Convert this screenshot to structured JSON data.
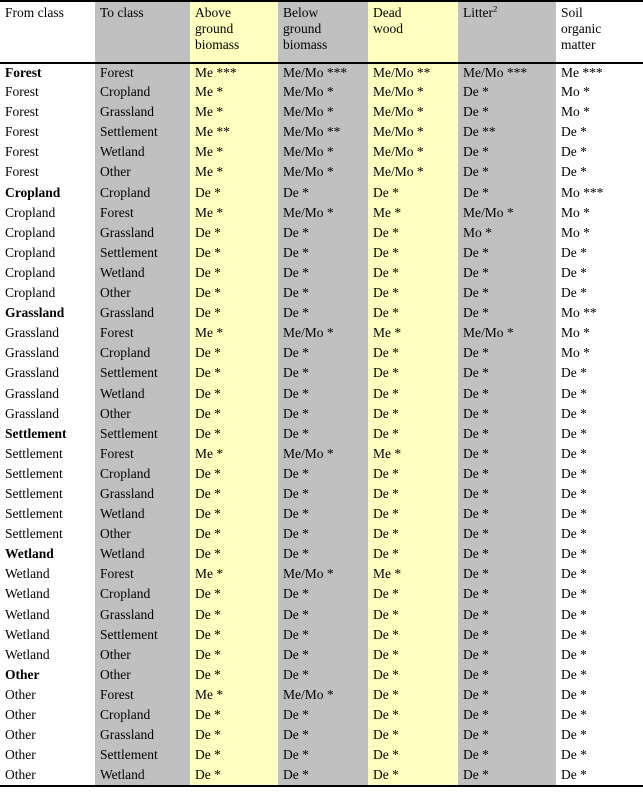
{
  "table": {
    "headers": [
      {
        "id": "from-class",
        "label": "From class",
        "lines": [
          "From class"
        ],
        "tint": "white",
        "superscript": ""
      },
      {
        "id": "to-class",
        "label": "To class",
        "lines": [
          "To class"
        ],
        "tint": "gray",
        "superscript": ""
      },
      {
        "id": "above-ground-biomass",
        "label": "Above ground biomass",
        "lines": [
          "Above",
          "ground",
          "biomass"
        ],
        "tint": "yellow",
        "superscript": ""
      },
      {
        "id": "below-ground-biomass",
        "label": "Below ground biomass",
        "lines": [
          "Below",
          "ground",
          "biomass"
        ],
        "tint": "gray",
        "superscript": ""
      },
      {
        "id": "dead-wood",
        "label": "Dead wood",
        "lines": [
          "Dead",
          "wood"
        ],
        "tint": "yellow",
        "superscript": ""
      },
      {
        "id": "litter",
        "label": "Litter",
        "lines": [
          "Litter"
        ],
        "tint": "gray",
        "superscript": "2"
      },
      {
        "id": "soil-organic-matter",
        "label": "Soil organic matter",
        "lines": [
          "Soil",
          "organic",
          "matter"
        ],
        "tint": "white",
        "superscript": ""
      }
    ],
    "column_tints": [
      "white",
      "gray",
      "yellow",
      "gray",
      "yellow",
      "gray",
      "white"
    ],
    "colors": {
      "yellow_tint": "#ffffc0",
      "gray_tint": "#c0c0c0",
      "white_tint": "#ffffff",
      "border": "#000000",
      "text": "#000000"
    },
    "rows": [
      {
        "from": "Forest",
        "from_bold": true,
        "to": "Forest",
        "values": [
          "Me ***",
          "Me/Mo ***",
          "Me/Mo **",
          "Me/Mo ***",
          "Me ***"
        ]
      },
      {
        "from": "Forest",
        "from_bold": false,
        "to": "Cropland",
        "values": [
          "Me *",
          "Me/Mo *",
          "Me/Mo *",
          "De *",
          "Mo *"
        ]
      },
      {
        "from": "Forest",
        "from_bold": false,
        "to": "Grassland",
        "values": [
          "Me *",
          "Me/Mo *",
          "Me/Mo *",
          "De *",
          "Mo *"
        ]
      },
      {
        "from": "Forest",
        "from_bold": false,
        "to": "Settlement",
        "values": [
          "Me **",
          "Me/Mo **",
          "Me/Mo *",
          "De **",
          "De *"
        ]
      },
      {
        "from": "Forest",
        "from_bold": false,
        "to": "Wetland",
        "values": [
          "Me *",
          "Me/Mo *",
          "Me/Mo *",
          "De *",
          "De *"
        ]
      },
      {
        "from": "Forest",
        "from_bold": false,
        "to": "Other",
        "values": [
          "Me *",
          "Me/Mo *",
          "Me/Mo *",
          "De *",
          "De *"
        ]
      },
      {
        "from": "Cropland",
        "from_bold": true,
        "to": "Cropland",
        "values": [
          "De *",
          "De *",
          "De *",
          "De *",
          "Mo ***"
        ]
      },
      {
        "from": "Cropland",
        "from_bold": false,
        "to": "Forest",
        "values": [
          "Me *",
          "Me/Mo *",
          "Me *",
          "Me/Mo *",
          "Mo *"
        ]
      },
      {
        "from": "Cropland",
        "from_bold": false,
        "to": "Grassland",
        "values": [
          "De *",
          "De *",
          "De *",
          "Mo *",
          "Mo *"
        ]
      },
      {
        "from": "Cropland",
        "from_bold": false,
        "to": "Settlement",
        "values": [
          "De *",
          "De *",
          "De *",
          "De *",
          "De *"
        ]
      },
      {
        "from": "Cropland",
        "from_bold": false,
        "to": "Wetland",
        "values": [
          "De *",
          "De *",
          "De *",
          "De *",
          "De *"
        ]
      },
      {
        "from": "Cropland",
        "from_bold": false,
        "to": "Other",
        "values": [
          "De *",
          "De *",
          "De *",
          "De *",
          "De *"
        ]
      },
      {
        "from": "Grassland",
        "from_bold": true,
        "to": "Grassland",
        "values": [
          "De *",
          "De *",
          "De *",
          "De *",
          "Mo **"
        ]
      },
      {
        "from": "Grassland",
        "from_bold": false,
        "to": "Forest",
        "values": [
          "Me *",
          "Me/Mo *",
          "Me *",
          "Me/Mo *",
          "Mo *"
        ]
      },
      {
        "from": "Grassland",
        "from_bold": false,
        "to": "Cropland",
        "values": [
          "De *",
          "De *",
          "De *",
          "De *",
          "Mo *"
        ]
      },
      {
        "from": "Grassland",
        "from_bold": false,
        "to": "Settlement",
        "values": [
          "De *",
          "De *",
          "De *",
          "De *",
          "De *"
        ]
      },
      {
        "from": "Grassland",
        "from_bold": false,
        "to": "Wetland",
        "values": [
          "De *",
          "De *",
          "De *",
          "De *",
          "De *"
        ]
      },
      {
        "from": "Grassland",
        "from_bold": false,
        "to": "Other",
        "values": [
          "De *",
          "De *",
          "De *",
          "De *",
          "De *"
        ]
      },
      {
        "from": "Settlement",
        "from_bold": true,
        "to": "Settlement",
        "values": [
          "De *",
          "De *",
          "De *",
          "De *",
          "De *"
        ]
      },
      {
        "from": "Settlement",
        "from_bold": false,
        "to": "Forest",
        "values": [
          "Me *",
          "Me/Mo *",
          "Me *",
          "De *",
          "De *"
        ]
      },
      {
        "from": "Settlement",
        "from_bold": false,
        "to": "Cropland",
        "values": [
          "De *",
          "De *",
          "De *",
          "De *",
          "De *"
        ]
      },
      {
        "from": "Settlement",
        "from_bold": false,
        "to": "Grassland",
        "values": [
          "De *",
          "De *",
          "De *",
          "De *",
          "De *"
        ]
      },
      {
        "from": "Settlement",
        "from_bold": false,
        "to": "Wetland",
        "values": [
          "De *",
          "De *",
          "De *",
          "De *",
          "De *"
        ]
      },
      {
        "from": "Settlement",
        "from_bold": false,
        "to": "Other",
        "values": [
          "De *",
          "De *",
          "De *",
          "De *",
          "De *"
        ]
      },
      {
        "from": "Wetland",
        "from_bold": true,
        "to": "Wetland",
        "values": [
          "De *",
          "De *",
          "De *",
          "De *",
          "De *"
        ]
      },
      {
        "from": "Wetland",
        "from_bold": false,
        "to": "Forest",
        "values": [
          "Me *",
          "Me/Mo *",
          "Me *",
          "De *",
          "De *"
        ]
      },
      {
        "from": "Wetland",
        "from_bold": false,
        "to": "Cropland",
        "values": [
          "De *",
          "De *",
          "De *",
          "De *",
          "De *"
        ]
      },
      {
        "from": "Wetland",
        "from_bold": false,
        "to": "Grassland",
        "values": [
          "De *",
          "De *",
          "De *",
          "De *",
          "De *"
        ]
      },
      {
        "from": "Wetland",
        "from_bold": false,
        "to": "Settlement",
        "values": [
          "De *",
          "De *",
          "De *",
          "De *",
          "De *"
        ]
      },
      {
        "from": "Wetland",
        "from_bold": false,
        "to": "Other",
        "values": [
          "De *",
          "De *",
          "De *",
          "De *",
          "De *"
        ]
      },
      {
        "from": "Other",
        "from_bold": true,
        "to": "Other",
        "values": [
          "De *",
          "De *",
          "De *",
          "De *",
          "De *"
        ]
      },
      {
        "from": "Other",
        "from_bold": false,
        "to": "Forest",
        "values": [
          "Me *",
          "Me/Mo *",
          "De *",
          "De *",
          "De *"
        ]
      },
      {
        "from": "Other",
        "from_bold": false,
        "to": "Cropland",
        "values": [
          "De *",
          "De *",
          "De *",
          "De *",
          "De *"
        ]
      },
      {
        "from": "Other",
        "from_bold": false,
        "to": "Grassland",
        "values": [
          "De *",
          "De *",
          "De *",
          "De *",
          "De *"
        ]
      },
      {
        "from": "Other",
        "from_bold": false,
        "to": "Settlement",
        "values": [
          "De *",
          "De *",
          "De *",
          "De *",
          "De *"
        ]
      },
      {
        "from": "Other",
        "from_bold": false,
        "to": "Wetland",
        "values": [
          "De *",
          "De *",
          "De *",
          "De *",
          "De *"
        ]
      }
    ]
  }
}
